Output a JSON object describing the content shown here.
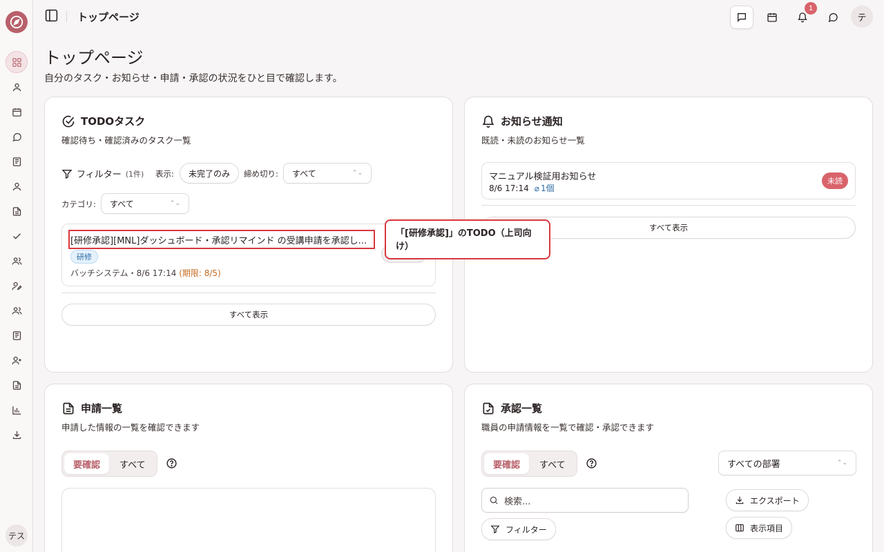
{
  "user": {
    "sidebar_initials": "テス",
    "header_initial": "テ"
  },
  "header": {
    "title": "トップページ",
    "notification_count": "1"
  },
  "page": {
    "title": "トップページ",
    "subtitle": "自分のタスク・お知らせ・申請・承認の状況をひと目で確認します。"
  },
  "todo": {
    "title": "TODOタスク",
    "description": "確認待ち・確認済みのタスク一覧",
    "filter_label": "フィルター",
    "filter_count": "(1件)",
    "display_label": "表示:",
    "display_value": "未完了のみ",
    "deadline_label": "締め切り:",
    "deadline_value": "すべて",
    "category_label": "カテゴリ:",
    "category_value": "すべて",
    "items": [
      {
        "text": "[研修承認][MNL]ダッシュボード・承認リマインド の受講申請を承認し...",
        "tag": "研修",
        "meta": "バッチシステム・8/6 17:14",
        "deadline": "(期限: 8/5)"
      }
    ],
    "show_all": "すべて表示"
  },
  "tooltip": {
    "text": "「[研修承認]」のTODO（上司向け）"
  },
  "notices": {
    "title": "お知らせ通知",
    "description": "既読・未読のお知らせ一覧",
    "items": [
      {
        "title": "マニュアル検証用お知らせ",
        "time": "8/6 17:14",
        "attachments": "1個",
        "status": "未読"
      }
    ],
    "show_all": "すべて表示"
  },
  "applications": {
    "title": "申請一覧",
    "description": "申請した情報の一覧を確認できます",
    "tabs": [
      "要確認",
      "すべて"
    ]
  },
  "approvals": {
    "title": "承認一覧",
    "description": "職員の申請情報を一覧で確認・承認できます",
    "tabs": [
      "要確認",
      "すべて"
    ],
    "department_select": "すべての部署",
    "search_placeholder": "検索...",
    "export_label": "エクスポート",
    "filter_label": "フィルター",
    "columns_label": "表示項目"
  },
  "colors": {
    "accent": "#b8606a",
    "badge": "#d9636b",
    "highlight": "#d9363e",
    "tag": "#2d6aa6"
  }
}
